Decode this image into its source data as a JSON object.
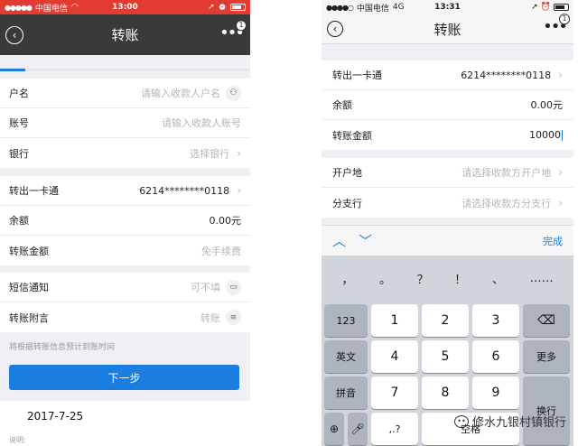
{
  "left": {
    "status": {
      "carrier": "中国电信",
      "time": "13:00"
    },
    "nav": {
      "title": "转账",
      "badge": "1"
    },
    "progress": 0.1,
    "payee": [
      {
        "label": "户名",
        "placeholder": "请输入收款人户名",
        "icon": "person-icon"
      },
      {
        "label": "账号",
        "placeholder": "请输入收款人账号"
      },
      {
        "label": "银行",
        "placeholder": "选择银行",
        "chevron": true
      }
    ],
    "account": [
      {
        "label": "转出一卡通",
        "value": "6214********0118",
        "chevron": true
      },
      {
        "label": "余额",
        "value": "0.00元"
      },
      {
        "label": "转账金额",
        "placeholder": "免手续费"
      }
    ],
    "extras": [
      {
        "label": "短信通知",
        "placeholder": "可不填",
        "icon": "book-icon"
      },
      {
        "label": "转账附言",
        "placeholder": "转账",
        "icon": "list-icon"
      }
    ],
    "hint": "将根据转账信息预计到账时间",
    "next_label": "下一步",
    "date": "2017-7-25",
    "note": "说明:"
  },
  "right": {
    "status": {
      "carrier": "中国电信",
      "network": "4G",
      "time": "13:31"
    },
    "nav": {
      "title": "转账",
      "badge": "1"
    },
    "account": [
      {
        "label": "转出一卡通",
        "value": "6214********0118",
        "chevron": true
      },
      {
        "label": "余额",
        "value": "0.00元"
      },
      {
        "label": "转账金额",
        "value": "10000"
      }
    ],
    "payee": [
      {
        "label": "开户地",
        "placeholder": "请选择收款方开户地",
        "chevron": true
      },
      {
        "label": "分支行",
        "placeholder": "请选择收款方分支行",
        "chevron": true
      }
    ],
    "toolbar": {
      "done_label": "完成"
    },
    "punctuation": [
      "，",
      "。",
      "？",
      "！",
      "、",
      "……"
    ],
    "keys": {
      "mode_123": "123",
      "mode_en": "英文",
      "mode_pinyin": "拼音",
      "more": "更多",
      "enter": "换行",
      "space": "空格",
      "d1": "1",
      "d2": "2",
      "d3": "3",
      "d4": "4",
      "d5": "5",
      "d6": "6",
      "d7": "7",
      "d8": "8",
      "d9": "9",
      "comma": ",.?"
    },
    "watermark": "修水九银村镇银行"
  }
}
